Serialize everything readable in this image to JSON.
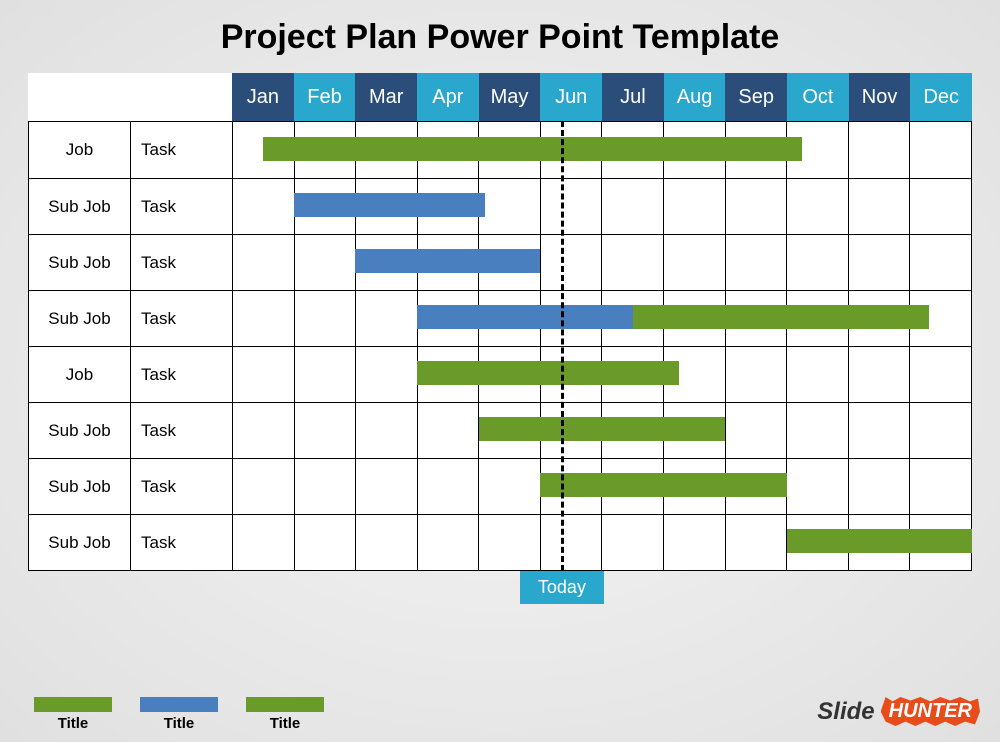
{
  "title": "Project Plan Power Point Template",
  "months": [
    "Jan",
    "Feb",
    "Mar",
    "Apr",
    "May",
    "Jun",
    "Jul",
    "Aug",
    "Sep",
    "Oct",
    "Nov",
    "Dec"
  ],
  "month_colors": [
    "dark",
    "light",
    "dark",
    "light",
    "dark",
    "light",
    "dark",
    "light",
    "dark",
    "light",
    "dark",
    "light"
  ],
  "rows": [
    {
      "label": "Job",
      "task": "Task"
    },
    {
      "label": "Sub Job",
      "task": "Task"
    },
    {
      "label": "Sub Job",
      "task": "Task"
    },
    {
      "label": "Sub Job",
      "task": "Task"
    },
    {
      "label": "Job",
      "task": "Task"
    },
    {
      "label": "Sub Job",
      "task": "Task"
    },
    {
      "label": "Sub Job",
      "task": "Task"
    },
    {
      "label": "Sub Job",
      "task": "Task"
    }
  ],
  "today": {
    "label": "Today",
    "month_fraction": 5.35
  },
  "legend": [
    {
      "color": "#6a9a2a",
      "label": "Title"
    },
    {
      "color": "#4a7fbf",
      "label": "Title"
    },
    {
      "color": "#6a9a2a",
      "label": "Title"
    }
  ],
  "branding": {
    "part1": "Slide",
    "part2": "HUNTER"
  },
  "colors": {
    "green": "#6a9a2a",
    "blue": "#4a7fbf",
    "dark": "#2b4d7a",
    "light": "#29a7cc"
  },
  "chart_data": {
    "type": "gantt",
    "title": "Project Plan Power Point Template",
    "categories": [
      "Jan",
      "Feb",
      "Mar",
      "Apr",
      "May",
      "Jun",
      "Jul",
      "Aug",
      "Sep",
      "Oct",
      "Nov",
      "Dec"
    ],
    "today": 5.35,
    "series": [
      {
        "row": 0,
        "name": "Job",
        "task": "Task",
        "segments": [
          {
            "start": 0.5,
            "end": 5.35,
            "color": "green"
          },
          {
            "start": 5.35,
            "end": 9.25,
            "color": "green"
          }
        ]
      },
      {
        "row": 1,
        "name": "Sub Job",
        "task": "Task",
        "segments": [
          {
            "start": 1.0,
            "end": 4.1,
            "color": "blue"
          }
        ]
      },
      {
        "row": 2,
        "name": "Sub Job",
        "task": "Task",
        "segments": [
          {
            "start": 2.0,
            "end": 5.0,
            "color": "blue"
          }
        ]
      },
      {
        "row": 3,
        "name": "Sub Job",
        "task": "Task",
        "segments": [
          {
            "start": 3.0,
            "end": 6.5,
            "color": "blue"
          },
          {
            "start": 6.5,
            "end": 11.3,
            "color": "green"
          }
        ]
      },
      {
        "row": 4,
        "name": "Job",
        "task": "Task",
        "segments": [
          {
            "start": 3.0,
            "end": 7.25,
            "color": "green"
          }
        ]
      },
      {
        "row": 5,
        "name": "Sub Job",
        "task": "Task",
        "segments": [
          {
            "start": 4.0,
            "end": 8.0,
            "color": "green"
          }
        ]
      },
      {
        "row": 6,
        "name": "Sub Job",
        "task": "Task",
        "segments": [
          {
            "start": 5.0,
            "end": 9.0,
            "color": "green"
          }
        ]
      },
      {
        "row": 7,
        "name": "Sub Job",
        "task": "Task",
        "segments": [
          {
            "start": 9.0,
            "end": 12.0,
            "color": "green"
          }
        ]
      }
    ]
  }
}
